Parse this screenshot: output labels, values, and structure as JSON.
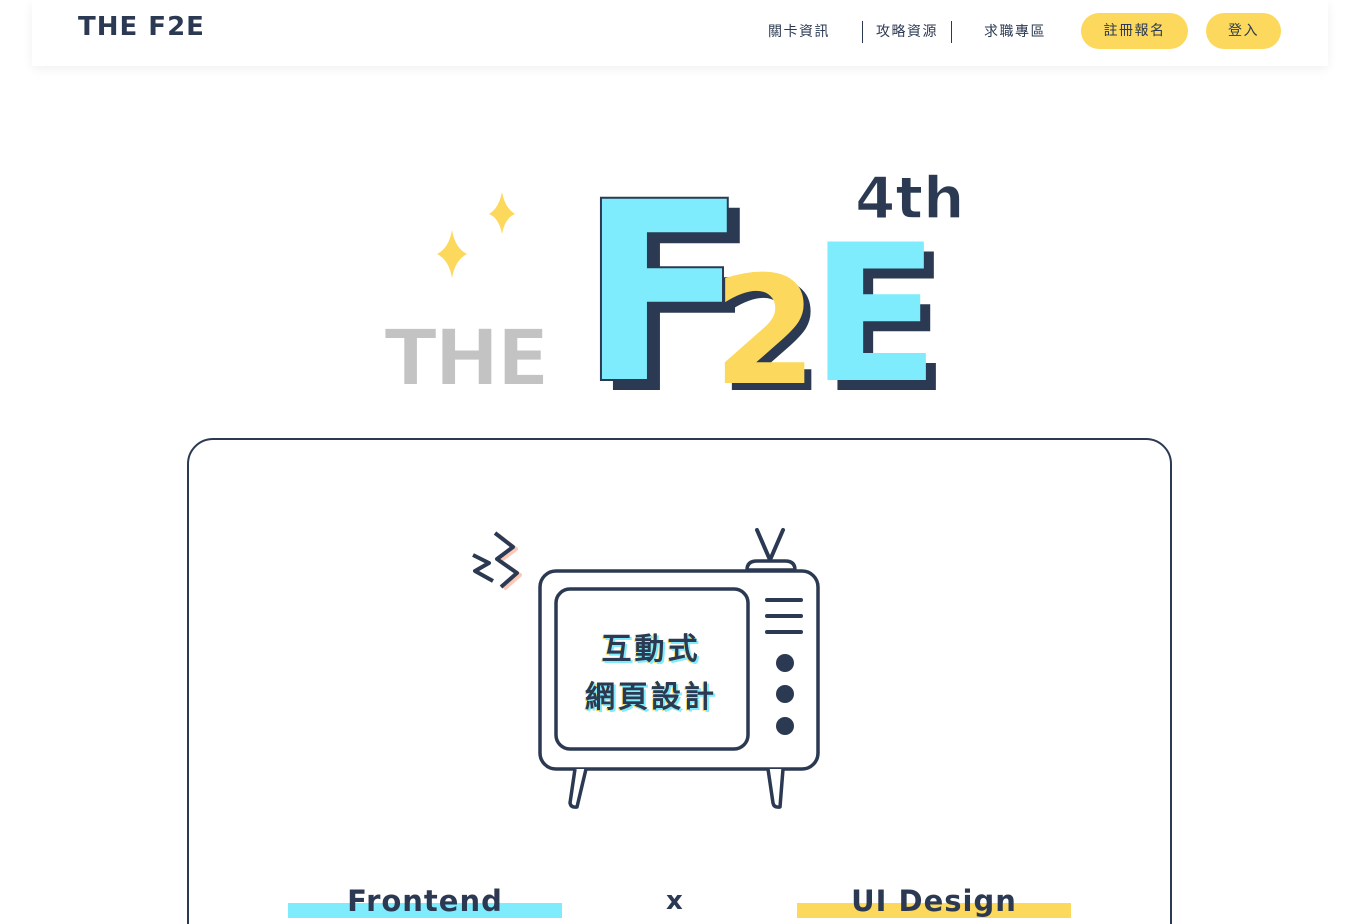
{
  "header": {
    "logo": "THE F2E",
    "nav": [
      "關卡資訊",
      "攻略資源",
      "求職專區"
    ],
    "register_label": "註冊報名",
    "login_label": "登入"
  },
  "hero": {
    "the": "THE",
    "f": "F",
    "two": "2",
    "e": "E",
    "edition": "4th"
  },
  "card": {
    "tv_line1": "互動式",
    "tv_line2": "網頁設計",
    "frontend_label": "Frontend",
    "times": "x",
    "design_label": "UI Design"
  },
  "colors": {
    "navy": "#2b3a52",
    "cyan": "#7eecfc",
    "yellow": "#fcd85d",
    "gray": "#c0c0c0"
  }
}
